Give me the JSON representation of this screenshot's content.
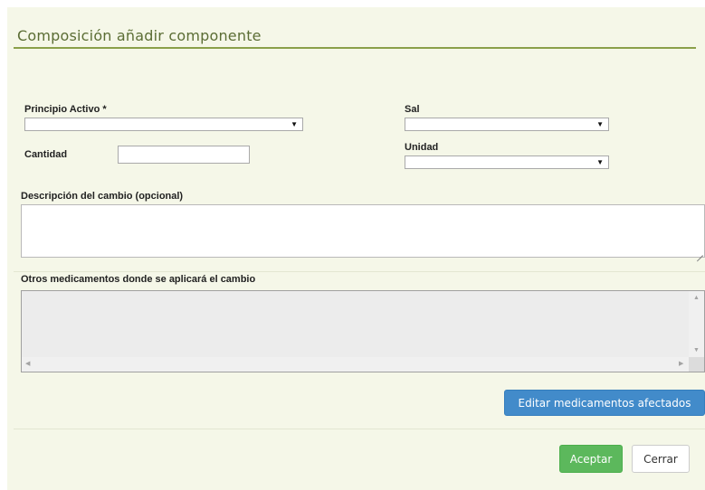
{
  "dialog": {
    "title": "Composición añadir componente"
  },
  "form": {
    "principio_activo": {
      "label": "Principio Activo *",
      "value": ""
    },
    "sal": {
      "label": "Sal",
      "value": ""
    },
    "cantidad": {
      "label": "Cantidad",
      "value": ""
    },
    "unidad": {
      "label": "Unidad",
      "value": ""
    },
    "descripcion": {
      "label": "Descripción del cambio (opcional)",
      "value": ""
    },
    "otros_medicamentos": {
      "label": "Otros medicamentos donde se aplicará el cambio"
    }
  },
  "icons": {
    "dropdown_arrow": "▼",
    "scroll_up": "▲",
    "scroll_down": "▼",
    "scroll_left": "◀",
    "scroll_right": "▶"
  },
  "buttons": {
    "edit_label": "Editar medicamentos afectados",
    "accept_label": "Aceptar",
    "close_label": "Cerrar"
  },
  "colors": {
    "background": "#f5f7e8",
    "title": "#5b6d34",
    "title_rule": "#8aa04a",
    "primary": "#428bca",
    "success": "#5cb85c"
  }
}
